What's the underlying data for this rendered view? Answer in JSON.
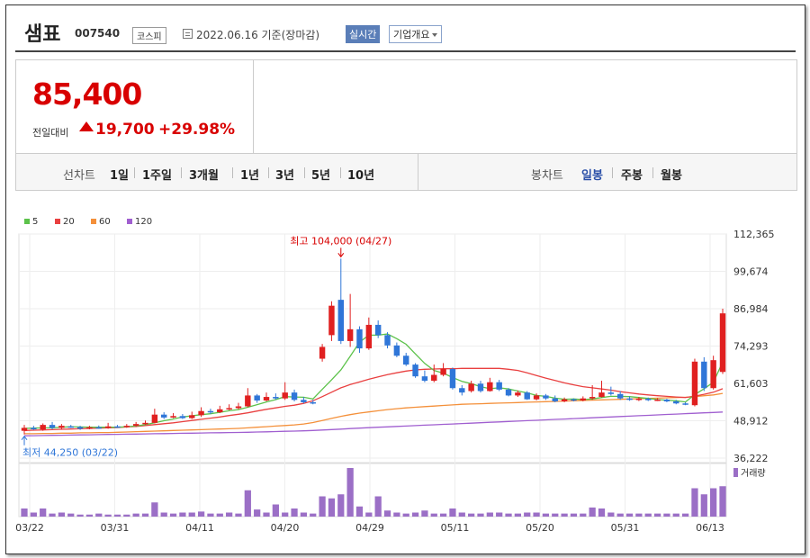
{
  "header": {
    "name": "샘표",
    "code": "007540",
    "market": "코스피",
    "date": "2022.06.16 기준(장마감)",
    "realtime_label": "실시간",
    "company_label": "기업개요"
  },
  "quote": {
    "price": "85,400",
    "change_label": "전일대비",
    "change": "19,700",
    "change_pct": "+29.98%"
  },
  "periods": {
    "label": "선차트",
    "items": [
      "1일",
      "1주일",
      "3개월",
      "1년",
      "3년",
      "5년",
      "10년"
    ]
  },
  "candle_types": {
    "label": "봉차트",
    "items": [
      "일봉",
      "주봉",
      "월봉"
    ],
    "active": "일봉"
  },
  "colors": {
    "up": "#e02020",
    "down": "#2f76d8",
    "ma5": "#5cc24a",
    "ma20": "#e94040",
    "ma60": "#f4903a",
    "ma120": "#a05fd0",
    "volume": "#9b6fc6"
  },
  "chart_data": {
    "type": "candlestick",
    "legend": [
      "5",
      "20",
      "60",
      "120"
    ],
    "x_ticks": [
      "03/22",
      "03/31",
      "04/11",
      "04/20",
      "04/29",
      "05/11",
      "05/20",
      "05/31",
      "06/13"
    ],
    "y_ticks": [
      "112,365",
      "99,674",
      "86,984",
      "74,293",
      "61,603",
      "48,912",
      "36,222"
    ],
    "ylim": [
      36222,
      112365
    ],
    "high_label": "최고 104,000 (04/27)",
    "low_label": "최저 44,250 (03/22)",
    "volume_label": "거래량",
    "candles": [
      [
        45500,
        46500,
        44250,
        47500
      ],
      [
        46500,
        46000,
        45800,
        47200
      ],
      [
        46000,
        47500,
        45500,
        48000
      ],
      [
        47500,
        46500,
        46000,
        48500
      ],
      [
        46500,
        47200,
        46000,
        47800
      ],
      [
        47000,
        46800,
        46500,
        47500
      ],
      [
        46800,
        46200,
        45800,
        47200
      ],
      [
        46200,
        46700,
        46000,
        47200
      ],
      [
        46700,
        46500,
        46200,
        47300
      ],
      [
        46500,
        47000,
        46200,
        48200
      ],
      [
        47000,
        46800,
        46500,
        47500
      ],
      [
        46800,
        47200,
        46500,
        47800
      ],
      [
        47200,
        47800,
        46800,
        48500
      ],
      [
        47800,
        48200,
        47500,
        49000
      ],
      [
        48200,
        51000,
        48000,
        53000
      ],
      [
        51000,
        50000,
        49500,
        51800
      ],
      [
        50000,
        50500,
        49800,
        51500
      ],
      [
        50500,
        49800,
        49500,
        51200
      ],
      [
        49800,
        50800,
        49500,
        52000
      ],
      [
        50800,
        52200,
        50200,
        53500
      ],
      [
        52200,
        51800,
        51200,
        53000
      ],
      [
        51800,
        52800,
        51500,
        54000
      ],
      [
        52800,
        53200,
        52500,
        54500
      ],
      [
        53200,
        53800,
        52800,
        55000
      ],
      [
        53800,
        57500,
        53500,
        60000
      ],
      [
        57500,
        55800,
        55000,
        58000
      ],
      [
        55800,
        57000,
        55500,
        58500
      ],
      [
        57000,
        56500,
        56000,
        58200
      ],
      [
        56500,
        58500,
        56000,
        62000
      ],
      [
        58500,
        56000,
        55500,
        59500
      ],
      [
        56000,
        55200,
        54800,
        57000
      ],
      [
        55200,
        54800,
        54500,
        56000
      ],
      [
        70000,
        74000,
        69000,
        75000
      ],
      [
        78000,
        88000,
        76000,
        89500
      ],
      [
        90000,
        76000,
        75000,
        104000
      ],
      [
        76000,
        80000,
        74000,
        92000
      ],
      [
        80000,
        73500,
        72000,
        81000
      ],
      [
        73500,
        81500,
        73000,
        84000
      ],
      [
        81500,
        78000,
        77000,
        83000
      ],
      [
        78000,
        74500,
        73500,
        79000
      ],
      [
        74500,
        71000,
        70500,
        75500
      ],
      [
        71000,
        68000,
        67500,
        72000
      ],
      [
        68000,
        64000,
        63500,
        68500
      ],
      [
        64000,
        62500,
        62000,
        66000
      ],
      [
        62500,
        64500,
        62000,
        68000
      ],
      [
        64500,
        66500,
        64000,
        68500
      ],
      [
        66500,
        60000,
        59500,
        67000
      ],
      [
        60000,
        58500,
        57500,
        61000
      ],
      [
        59000,
        61500,
        58500,
        62500
      ],
      [
        61500,
        59000,
        58500,
        62500
      ],
      [
        59000,
        62000,
        58800,
        63500
      ],
      [
        62000,
        59500,
        59000,
        62800
      ],
      [
        59500,
        57500,
        57200,
        60000
      ],
      [
        57500,
        58500,
        57000,
        59200
      ],
      [
        58500,
        56200,
        56000,
        59000
      ],
      [
        56200,
        57500,
        55800,
        58200
      ],
      [
        57500,
        56500,
        56000,
        58000
      ],
      [
        56500,
        55500,
        55200,
        57500
      ],
      [
        55500,
        56200,
        55200,
        56800
      ],
      [
        56200,
        55800,
        55500,
        56500
      ],
      [
        55800,
        56500,
        55500,
        57200
      ],
      [
        56500,
        57000,
        56000,
        61000
      ],
      [
        57000,
        58500,
        56800,
        62500
      ],
      [
        58500,
        58000,
        57500,
        60500
      ],
      [
        58000,
        56500,
        56000,
        59000
      ],
      [
        56500,
        56000,
        55700,
        57200
      ],
      [
        56000,
        56400,
        55600,
        57000
      ],
      [
        56400,
        55900,
        55600,
        56800
      ],
      [
        55900,
        56100,
        55600,
        56600
      ],
      [
        56100,
        55500,
        55200,
        56400
      ],
      [
        55500,
        54800,
        54500,
        56000
      ],
      [
        54800,
        54500,
        54200,
        55200
      ],
      [
        54200,
        69000,
        53800,
        70000
      ],
      [
        69000,
        60000,
        59000,
        70500
      ],
      [
        60000,
        69500,
        59500,
        71000
      ],
      [
        65500,
        85400,
        64800,
        87000
      ]
    ],
    "ma5": [
      46300,
      46400,
      46500,
      46500,
      46700,
      46900,
      46800,
      46700,
      46700,
      46700,
      46700,
      46900,
      47100,
      47600,
      48200,
      48900,
      49500,
      50200,
      50600,
      51000,
      51300,
      51800,
      52300,
      52700,
      53500,
      54400,
      55300,
      56100,
      57100,
      57000,
      56900,
      56300,
      59600,
      62800,
      66200,
      70800,
      75600,
      78000,
      78000,
      78400,
      76800,
      74900,
      71600,
      68400,
      66000,
      65100,
      63600,
      62300,
      61500,
      60500,
      59800,
      60100,
      59700,
      59000,
      58400,
      57500,
      57200,
      56600,
      56200,
      56300,
      56100,
      56300,
      56800,
      57200,
      57200,
      57100,
      56800,
      56500,
      56100,
      55900,
      55700,
      55300,
      57800,
      59800,
      62000,
      68900
    ],
    "ma20": [
      45600,
      45700,
      45800,
      45900,
      46000,
      46100,
      46200,
      46300,
      46400,
      46500,
      46600,
      46800,
      47000,
      47300,
      47600,
      47900,
      48200,
      48600,
      49000,
      49400,
      49800,
      50200,
      50700,
      51100,
      51600,
      52200,
      52800,
      53300,
      53800,
      54200,
      54800,
      55700,
      57100,
      58600,
      60100,
      61200,
      62100,
      63000,
      63800,
      64600,
      65200,
      65800,
      66200,
      66400,
      66500,
      66600,
      66600,
      66700,
      66700,
      66700,
      66700,
      66700,
      66400,
      66000,
      65200,
      64300,
      63400,
      62600,
      61800,
      61100,
      60500,
      60100,
      59700,
      59300,
      58800,
      58400,
      58000,
      57700,
      57400,
      57200,
      57000,
      56800,
      57300,
      57900,
      58600,
      59800
    ],
    "ma60": [
      44500,
      44500,
      44600,
      44600,
      44700,
      44700,
      44800,
      44800,
      44900,
      44900,
      45000,
      45100,
      45200,
      45300,
      45400,
      45500,
      45600,
      45700,
      45800,
      45900,
      46000,
      46100,
      46200,
      46300,
      46500,
      46700,
      46900,
      47100,
      47300,
      47500,
      47800,
      48300,
      49000,
      49700,
      50400,
      51000,
      51500,
      51900,
      52300,
      52700,
      53000,
      53300,
      53500,
      53700,
      53900,
      54100,
      54300,
      54500,
      54600,
      54700,
      54800,
      54900,
      55000,
      55100,
      55200,
      55300,
      55400,
      55500,
      55600,
      55700,
      55800,
      55900,
      56000,
      56100,
      56200,
      56300,
      56400,
      56500,
      56600,
      56700,
      56800,
      56900,
      57100,
      57400,
      57700,
      58200
    ],
    "ma120": [
      43800,
      43850,
      43900,
      43950,
      44000,
      44050,
      44100,
      44150,
      44200,
      44250,
      44300,
      44350,
      44400,
      44450,
      44500,
      44550,
      44600,
      44650,
      44700,
      44750,
      44800,
      44850,
      44900,
      44950,
      45000,
      45080,
      45160,
      45240,
      45320,
      45400,
      45480,
      45600,
      45760,
      45920,
      46080,
      46240,
      46400,
      46560,
      46700,
      46840,
      46980,
      47120,
      47260,
      47400,
      47540,
      47680,
      47820,
      47960,
      48100,
      48240,
      48380,
      48520,
      48660,
      48800,
      48940,
      49080,
      49220,
      49360,
      49500,
      49640,
      49780,
      49920,
      50060,
      50200,
      50340,
      50480,
      50620,
      50760,
      50900,
      51040,
      51180,
      51320,
      51460,
      51600,
      51740,
      51880
    ],
    "volume": [
      8,
      4,
      8,
      3,
      4,
      3,
      2,
      2,
      3,
      2,
      2,
      2,
      3,
      3,
      14,
      4,
      3,
      4,
      4,
      5,
      3,
      3,
      4,
      3,
      26,
      7,
      4,
      12,
      4,
      8,
      4,
      3,
      20,
      18,
      22,
      48,
      10,
      4,
      20,
      6,
      4,
      3,
      4,
      6,
      3,
      3,
      8,
      4,
      3,
      3,
      4,
      4,
      3,
      3,
      4,
      4,
      3,
      3,
      3,
      3,
      3,
      9,
      8,
      4,
      3,
      3,
      3,
      3,
      3,
      3,
      3,
      3,
      28,
      22,
      28,
      30
    ]
  }
}
